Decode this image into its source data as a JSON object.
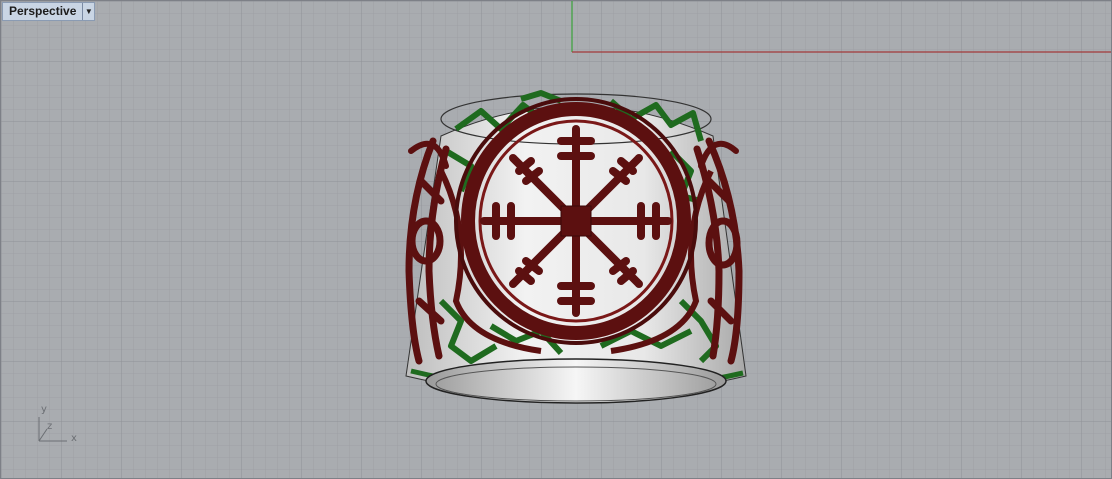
{
  "viewport": {
    "title": "Perspective",
    "dropdown_icon": "triangle-down-icon",
    "background_color": "#a9acb0",
    "grid_color": "#9a9da2",
    "x_axis_color": "#a33a3a",
    "y_axis_color": "#3aa33a"
  },
  "axis_widget": {
    "x_label": "x",
    "y_label": "y",
    "z_label": "z"
  },
  "model": {
    "metal_color": "#5c1010",
    "inlay_color": "#1f6b1f",
    "body_color": "#e2e2e2"
  }
}
